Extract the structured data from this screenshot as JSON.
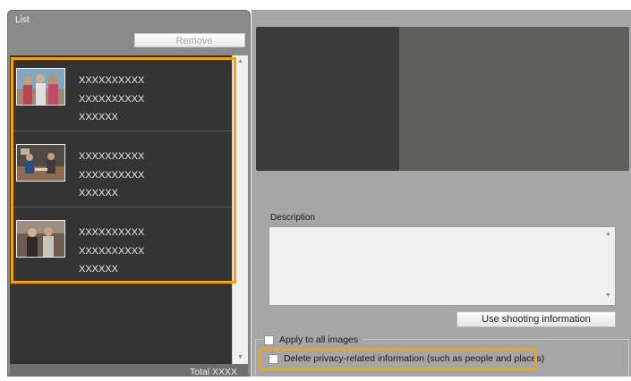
{
  "list_panel": {
    "title": "List",
    "remove_label": "Remove",
    "items": [
      {
        "line1": "XXXXXXXXXX",
        "line2": "XXXXXXXXXX",
        "line3": "XXXXXX",
        "thumbnail": "photo-three-women"
      },
      {
        "line1": "XXXXXXXXXX",
        "line2": "XXXXXXXXXX",
        "line3": "XXXXXX",
        "thumbnail": "photo-cafe-table"
      },
      {
        "line1": "XXXXXXXXXX",
        "line2": "XXXXXXXXXX",
        "line3": "XXXXXX",
        "thumbnail": "photo-two-people"
      }
    ],
    "total_label": "Total XXXX"
  },
  "details_panel": {
    "description_label": "Description",
    "description_value": "",
    "shooting_info_button": "Use shooting information",
    "apply_all_label": "Apply to all images",
    "delete_privacy_label": "Delete privacy-related information (such as people and places)",
    "apply_all_checked": false,
    "delete_privacy_checked": false
  },
  "colors": {
    "highlight": "#f5a400",
    "list_background": "#343434",
    "panel_background": "#a6a6a6"
  }
}
